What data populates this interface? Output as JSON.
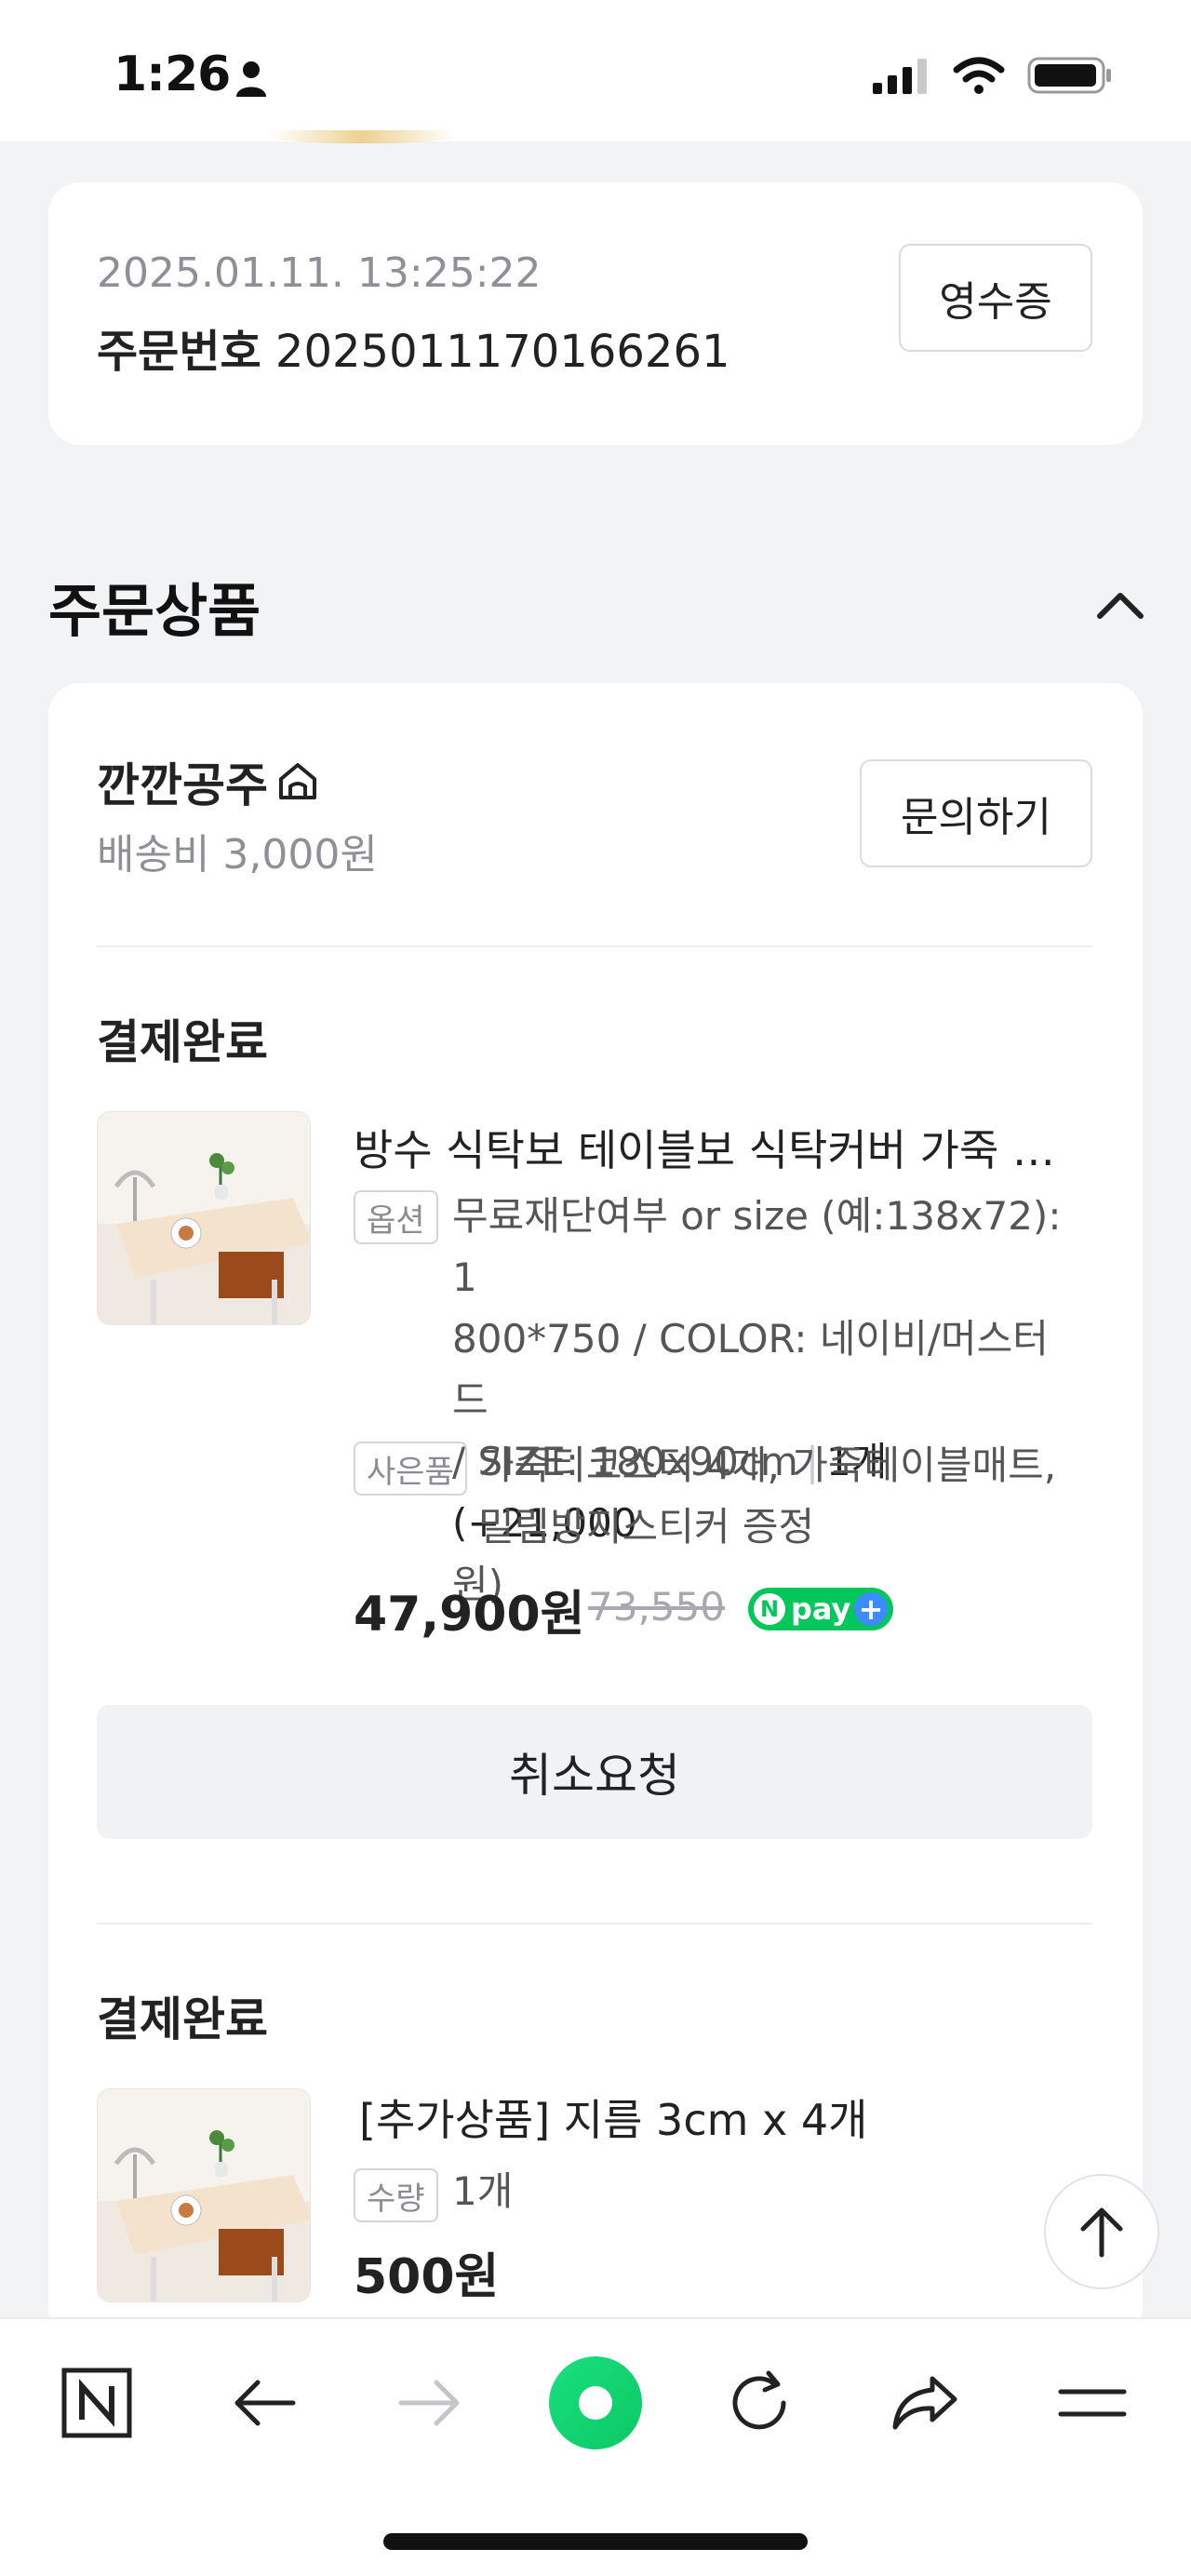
{
  "status_bar": {
    "time": "1:26"
  },
  "order_header": {
    "date": "2025.01.11. 13:25:22",
    "order_label": "주문번호",
    "order_number": "2025011170166261",
    "receipt_button": "영수증"
  },
  "section": {
    "title": "주문상품"
  },
  "seller": {
    "name": "깐깐공주",
    "shipping": "배송비 3,000원",
    "inquiry_button": "문의하기"
  },
  "items": [
    {
      "status": "결제완료",
      "name": "방수 식탁보 테이블보 식탁커버 가죽 …",
      "option_tag": "옵션",
      "option_lines": [
        "무료재단여부 or size (예:138x72): 1",
        "800*750 / COLOR: 네이비/머스터드",
        "/ SIZE: 180x90cm"
      ],
      "option_qty": "1개 (+21,000",
      "option_tail": "원)",
      "gift_tag": "사은품",
      "gift_lines": [
        "가죽티코스터 4개, 가죽테이블매트,",
        "밀림방지스티커 증정"
      ],
      "price": "47,900원",
      "original_price": "73,550",
      "npay_label": "pay",
      "cancel_button": "취소요청"
    },
    {
      "status": "결제완료",
      "name": "[추가상품] 지름 3cm x 4개",
      "qty_tag": "수량",
      "qty": "1개",
      "price": "500원"
    }
  ],
  "icons": {
    "person": "person-icon",
    "signal": "cellular-signal-icon",
    "wifi": "wifi-icon",
    "battery": "battery-icon",
    "store": "store-home-icon",
    "collapse": "chevron-up-icon",
    "scroll_top": "arrow-up-icon",
    "toolbar": [
      "naver-n-icon",
      "back-arrow-icon",
      "forward-arrow-icon",
      "green-dot-icon",
      "reload-icon",
      "share-icon",
      "menu-icon"
    ]
  },
  "colors": {
    "npay_green": "#03c75a",
    "npay_blue": "#3a8cff",
    "accent_green": "#16d96e"
  }
}
